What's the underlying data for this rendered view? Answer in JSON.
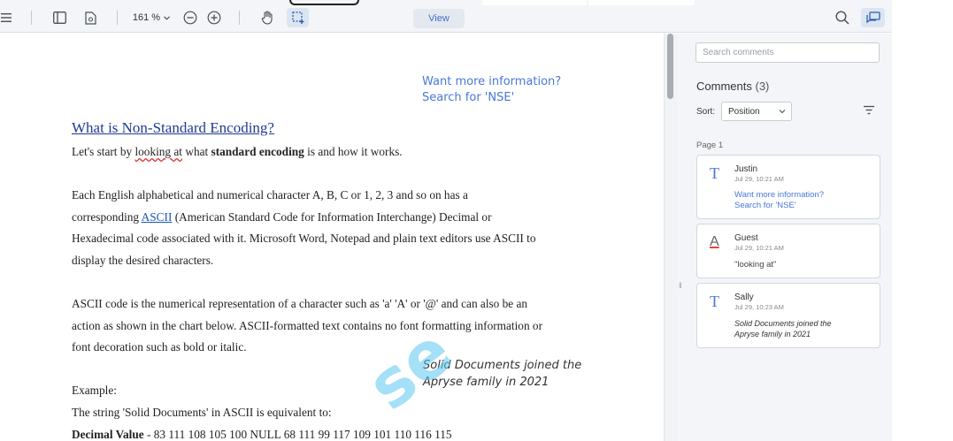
{
  "toolbar": {
    "zoom_label": "161 %",
    "view_label": "View",
    "icons": [
      "menu-icon",
      "panel-toggle-icon",
      "document-icon",
      "zoom-out-icon",
      "zoom-in-icon",
      "pan-hand-icon",
      "area-select-icon",
      "search-icon",
      "comments-icon"
    ]
  },
  "document": {
    "annotation_free_text": {
      "line1": "Want more information?",
      "line2": "Search for 'NSE'"
    },
    "title": "What is Non-Standard Encoding?",
    "intro": {
      "pre": "Let's start by ",
      "highlight": "looking at",
      "mid": " what ",
      "bold": "standard encoding",
      "post": " is and how it works."
    },
    "para1": {
      "line1": "Each English alphabetical and numerical character A, B, C or 1, 2, 3 and so on has a",
      "line2_pre": "corresponding ",
      "line2_link": "ASCII",
      "line2_post": " (American Standard Code for Information Interchange) Decimal or",
      "line3": "Hexadecimal code associated with it. Microsoft Word, Notepad and plain text editors use ASCII to",
      "line4": "display the desired characters."
    },
    "para2": {
      "line1": "ASCII code is the numerical representation of a character such as 'a' 'A' or '@' and can also be an",
      "line2": "action as shown in the chart below. ASCII-formatted text contains no font formatting information or",
      "line3": "font decoration such as bold or italic."
    },
    "annotation_italic": {
      "line1": "Solid Documents joined the",
      "line2": "Apryse family in 2021"
    },
    "example_label": "Example:",
    "example_line": "The string 'Solid Documents' in ASCII is equivalent to:",
    "decimal_label": "Decimal Value",
    "decimal_values": " - 83 111 108 105 100 NULL 68 111 99 117 109 101 110 116 115",
    "watermark": "se"
  },
  "comments_panel": {
    "search_placeholder": "Search comments",
    "heading": "Comments",
    "count": "(3)",
    "sort_label": "Sort:",
    "sort_value": "Position",
    "page_label": "Page 1",
    "colors": {
      "blue": "#4a78d6",
      "red": "#e0433b",
      "accent": "#3e71c4"
    },
    "cards": [
      {
        "icon": "T",
        "author": "Justin",
        "time": "Jul 29, 10:21 AM",
        "line1": "Want more information?",
        "line2": "Search for 'NSE'"
      },
      {
        "icon": "A",
        "author": "Guest",
        "time": "Jul 29, 10:21 AM",
        "line1": "\"looking at\""
      },
      {
        "icon": "T",
        "author": "Sally",
        "time": "Jul 29, 10:23 AM",
        "line1": "Solid Documents joined the",
        "line2": "Apryse family in 2021"
      }
    ]
  }
}
